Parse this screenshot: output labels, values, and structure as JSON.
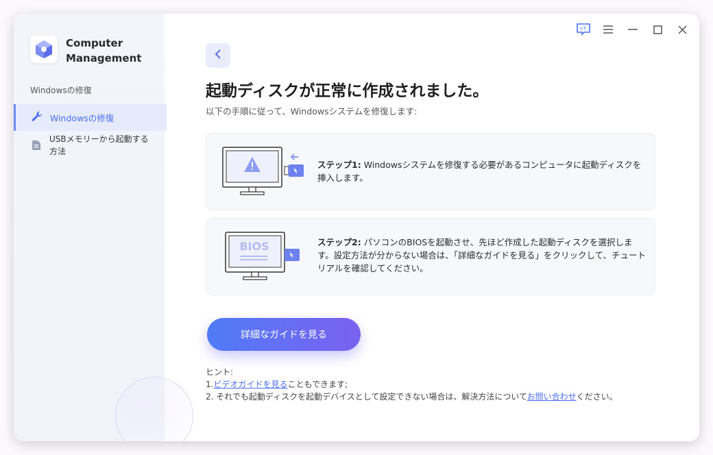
{
  "app": {
    "name": "Computer Management",
    "name_line1": "Computer",
    "name_line2": "Management"
  },
  "sidebar": {
    "section_label": "Windowsの修復",
    "items": [
      {
        "label": "Windowsの修復",
        "icon": "wrench-icon",
        "active": true
      },
      {
        "label": "USBメモリーから起動する方法",
        "icon": "document-icon",
        "active": false
      }
    ]
  },
  "topbar": {
    "icons": [
      "feedback-icon",
      "menu-icon",
      "minimize-icon",
      "maximize-icon",
      "close-icon"
    ]
  },
  "main": {
    "title": "起動ディスクが正常に作成されました。",
    "subtitle": "以下の手順に従って、Windowsシステムを修復します:",
    "steps": [
      {
        "label": "ステップ1:",
        "text": " Windowsシステムを修復する必要があるコンピュータに起動ディスクを挿入します。"
      },
      {
        "label": "ステップ2:",
        "text": " パソコンのBIOSを起動させ、先ほど作成した起動ディスクを選択します。設定方法が分からない場合は、「詳細なガイドを見る」をクリックして、チュートリアルを確認してください。",
        "screen_text": "BIOS"
      }
    ],
    "guide_button": "詳細なガイドを見る",
    "hints": {
      "title": "ヒント:",
      "line1_prefix": "1.",
      "line1_link": "ビデオガイドを見る",
      "line1_suffix": "こともできます;",
      "line2_prefix": "2. それでも起動ディスクを起動デバイスとして設定できない場合は、解決方法について",
      "line2_link": "お問い合わせ",
      "line2_suffix": "ください。"
    }
  },
  "colors": {
    "accent": "#4a6ef0",
    "button_start": "#4f7bf7",
    "button_end": "#7a62f0"
  }
}
